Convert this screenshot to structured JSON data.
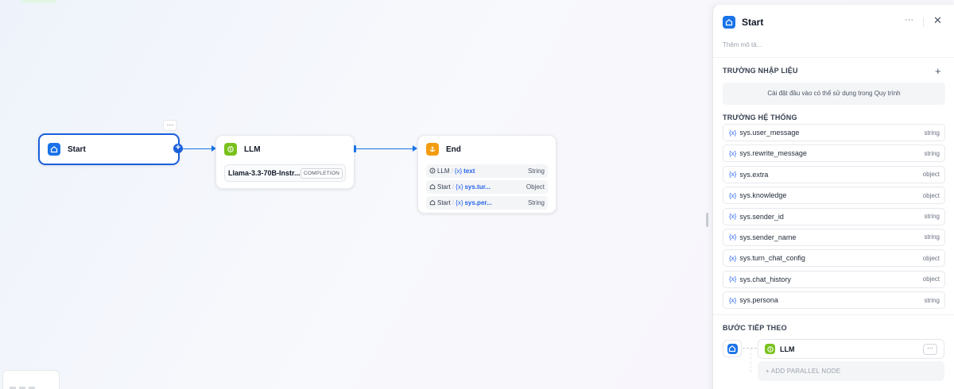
{
  "canvas": {
    "start_node": {
      "title": "Start",
      "more_label": "···",
      "add_label": "+"
    },
    "llm_node": {
      "title": "LLM",
      "model": "Llama-3.3-70B-Instr...",
      "mode_badge": "COMPLETION"
    },
    "end_node": {
      "title": "End",
      "outputs": [
        {
          "source": "LLM",
          "source_icon": "llm-icon",
          "var": "text",
          "type": "String"
        },
        {
          "source": "Start",
          "source_icon": "home-icon",
          "var": "sys.tur...",
          "type": "Object"
        },
        {
          "source": "Start",
          "source_icon": "home-icon",
          "var": "sys.per...",
          "type": "String"
        }
      ]
    },
    "var_prefix": "{x}",
    "separator": "/"
  },
  "panel": {
    "title": "Start",
    "more_label": "···",
    "close_label": "✕",
    "description_placeholder": "Thêm mô tả...",
    "input_section": {
      "title": "TRƯỜNG NHẬP LIỆU",
      "add_label": "+",
      "empty_text": "Cài đặt đầu vào có thể sử dụng trong Quy trình"
    },
    "system_section": {
      "title": "TRƯỜNG HỆ THỐNG",
      "var_prefix": "{x}",
      "fields": [
        {
          "name": "sys.user_message",
          "type": "string"
        },
        {
          "name": "sys.rewrite_message",
          "type": "string"
        },
        {
          "name": "sys.extra",
          "type": "object"
        },
        {
          "name": "sys.knowledge",
          "type": "object"
        },
        {
          "name": "sys.sender_id",
          "type": "string"
        },
        {
          "name": "sys.sender_name",
          "type": "string"
        },
        {
          "name": "sys.turn_chat_config",
          "type": "object"
        },
        {
          "name": "sys.chat_history",
          "type": "object"
        },
        {
          "name": "sys.persona",
          "type": "string"
        }
      ]
    },
    "next_section": {
      "title": "BƯỚC TIẾP THEO",
      "next_node": "LLM",
      "more_label": "···",
      "add_parallel_label": "+   ADD PARALLEL NODE"
    }
  },
  "colors": {
    "accent": "#1a5fdb",
    "start_icon": "#1a73e8",
    "llm_icon": "#79c11c",
    "end_icon": "#f39c12"
  }
}
